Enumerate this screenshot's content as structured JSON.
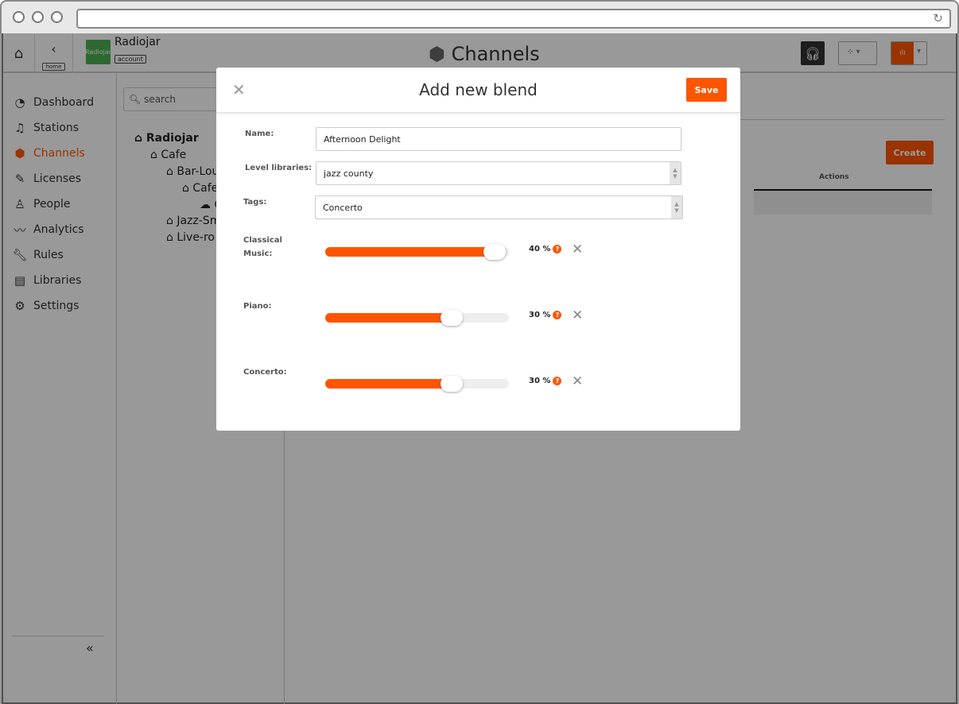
{
  "header": {
    "app_name": "Radiojar",
    "logo_text": "Radiojar",
    "account_label": "account",
    "home_label": "home",
    "title": "Channels"
  },
  "sidebar": {
    "items": [
      {
        "label": "Dashboard",
        "icon": "dashboard-icon"
      },
      {
        "label": "Stations",
        "icon": "stations-icon"
      },
      {
        "label": "Channels",
        "icon": "cube-icon",
        "active": true
      },
      {
        "label": "Licenses",
        "icon": "licenses-icon"
      },
      {
        "label": "People",
        "icon": "people-icon"
      },
      {
        "label": "Analytics",
        "icon": "analytics-icon"
      },
      {
        "label": "Rules",
        "icon": "wrench-icon"
      },
      {
        "label": "Libraries",
        "icon": "libraries-icon"
      },
      {
        "label": "Settings",
        "icon": "gear-icon"
      }
    ],
    "collapse": "«"
  },
  "tree": {
    "search_placeholder": "search",
    "nodes": [
      "Radiojar",
      "Cafe",
      "Bar-Lou",
      "Cafe",
      "C",
      "Jazz-Sm",
      "Live-ro"
    ]
  },
  "main": {
    "create_label": "Create",
    "actions_header": "Actions"
  },
  "colors": {
    "accent": "#ff5500",
    "logo": "#4caf50"
  },
  "modal": {
    "title": "Add new blend",
    "save_label": "Save",
    "name_label": "Name:",
    "name_value": "Afternoon Delight",
    "level_label": "Level libraries:",
    "level_value": "jazz county",
    "tags_label": "Tags:",
    "tags_value": "Concerto",
    "blends": [
      {
        "label": "Classical Music:",
        "percent": 40,
        "text": "40 %"
      },
      {
        "label": "Piano:",
        "percent": 30,
        "text": "30 %"
      },
      {
        "label": "Concerto:",
        "percent": 30,
        "text": "30 %"
      }
    ]
  }
}
